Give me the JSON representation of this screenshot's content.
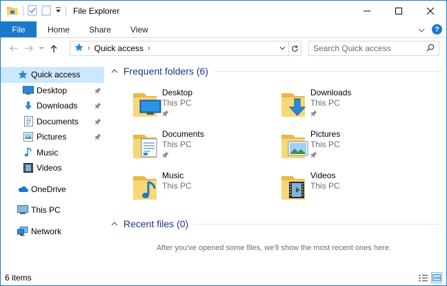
{
  "window": {
    "title": "File Explorer"
  },
  "ribbon": {
    "tabs": [
      "File",
      "Home",
      "Share",
      "View"
    ],
    "help": "?"
  },
  "address": {
    "crumb": "Quick access"
  },
  "search": {
    "placeholder": "Search Quick access"
  },
  "sidebar": {
    "items": [
      {
        "label": "Quick access",
        "icon": "star-icon"
      },
      {
        "label": "Desktop",
        "icon": "desktop-icon"
      },
      {
        "label": "Downloads",
        "icon": "download-arrow-icon"
      },
      {
        "label": "Documents",
        "icon": "documents-icon"
      },
      {
        "label": "Pictures",
        "icon": "pictures-icon"
      },
      {
        "label": "Music",
        "icon": "music-note-icon"
      },
      {
        "label": "Videos",
        "icon": "videos-icon"
      },
      {
        "label": "OneDrive",
        "icon": "cloud-icon"
      },
      {
        "label": "This PC",
        "icon": "computer-icon"
      },
      {
        "label": "Network",
        "icon": "network-icon"
      }
    ]
  },
  "main": {
    "frequent": {
      "title": "Frequent folders (6)",
      "folders": [
        {
          "name": "Desktop",
          "location": "This PC",
          "pinned": true,
          "icon": "desktop-folder-icon"
        },
        {
          "name": "Downloads",
          "location": "This PC",
          "pinned": true,
          "icon": "downloads-folder-icon"
        },
        {
          "name": "Documents",
          "location": "This PC",
          "pinned": true,
          "icon": "documents-folder-icon"
        },
        {
          "name": "Pictures",
          "location": "This PC",
          "pinned": true,
          "icon": "pictures-folder-icon"
        },
        {
          "name": "Music",
          "location": "This PC",
          "pinned": false,
          "icon": "music-folder-icon"
        },
        {
          "name": "Videos",
          "location": "This PC",
          "pinned": false,
          "icon": "videos-folder-icon"
        }
      ]
    },
    "recent": {
      "title": "Recent files (0)",
      "empty_message": "After you've opened some files, we'll show the most recent ones here."
    }
  },
  "status": {
    "count": "6 items"
  },
  "colors": {
    "accent": "#1979ca",
    "group_title": "#1e3287",
    "selected": "#cce8ff",
    "folder": "#f8d775"
  }
}
